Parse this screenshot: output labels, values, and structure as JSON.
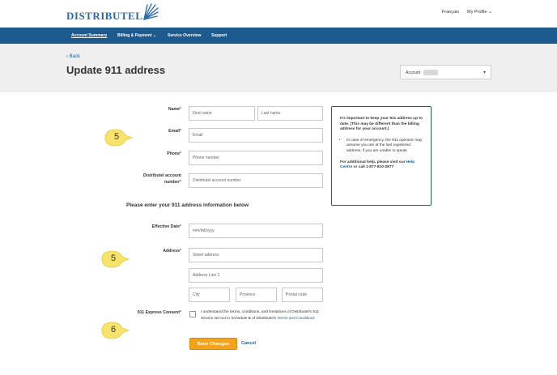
{
  "header": {
    "logo_text": "DISTRIBUTEL",
    "lang_link": "Français",
    "profile_link": "My Profile"
  },
  "nav": {
    "items": [
      {
        "label": "Account Summary",
        "active": true
      },
      {
        "label": "Billing & Payment",
        "has_dropdown": true
      },
      {
        "label": "Service Overview"
      },
      {
        "label": "Support"
      }
    ]
  },
  "page": {
    "back_label": "Back",
    "title": "Update 911 address",
    "account_label": "Account"
  },
  "form": {
    "name_label": "Name",
    "first_name_placeholder": "First name",
    "last_name_placeholder": "Last name",
    "email_label": "Email",
    "email_placeholder": "Email",
    "phone_label": "Phone",
    "phone_placeholder": "Phone number",
    "account_number_label_1": "Distributel account",
    "account_number_label_2": "number",
    "account_number_placeholder": "Distributel account number",
    "section_heading": "Please enter your 911 address information below",
    "effective_date_label": "Effective Date",
    "effective_date_placeholder": "mm/dd/yyyy",
    "address_label": "Address",
    "street_placeholder": "Street address",
    "address2_placeholder": "Address Line 2",
    "city_placeholder": "City",
    "province_placeholder": "Province",
    "postal_placeholder": "Postal code",
    "consent_label": "911 Express Consent",
    "consent_text": "I understand the terms, conditions, and limitations of Distributel's 911 service set out in Schedule B of Distributel's",
    "consent_link": "Terms and Conditions",
    "save_label": "Save Changes",
    "cancel_label": "Cancel",
    "required_mark": "*"
  },
  "infobox": {
    "intro": "It's important to keep your 911 address up to date. (This may be different than the billing address for your account.)",
    "bullet": "In case of emergency, the 911 operator may assume you are at the last registered address, if you are unable to speak",
    "help_prefix": "For additional help, please visit our",
    "help_link": "Help Centre",
    "help_suffix": "or call 1-877-810-2877"
  },
  "callouts": [
    "5",
    "5",
    "6"
  ],
  "colors": {
    "nav_bg": "#1d5b8f",
    "accent_button": "#f2a31b",
    "callout_fill": "#f7e36b",
    "link": "#1d5b8f"
  }
}
